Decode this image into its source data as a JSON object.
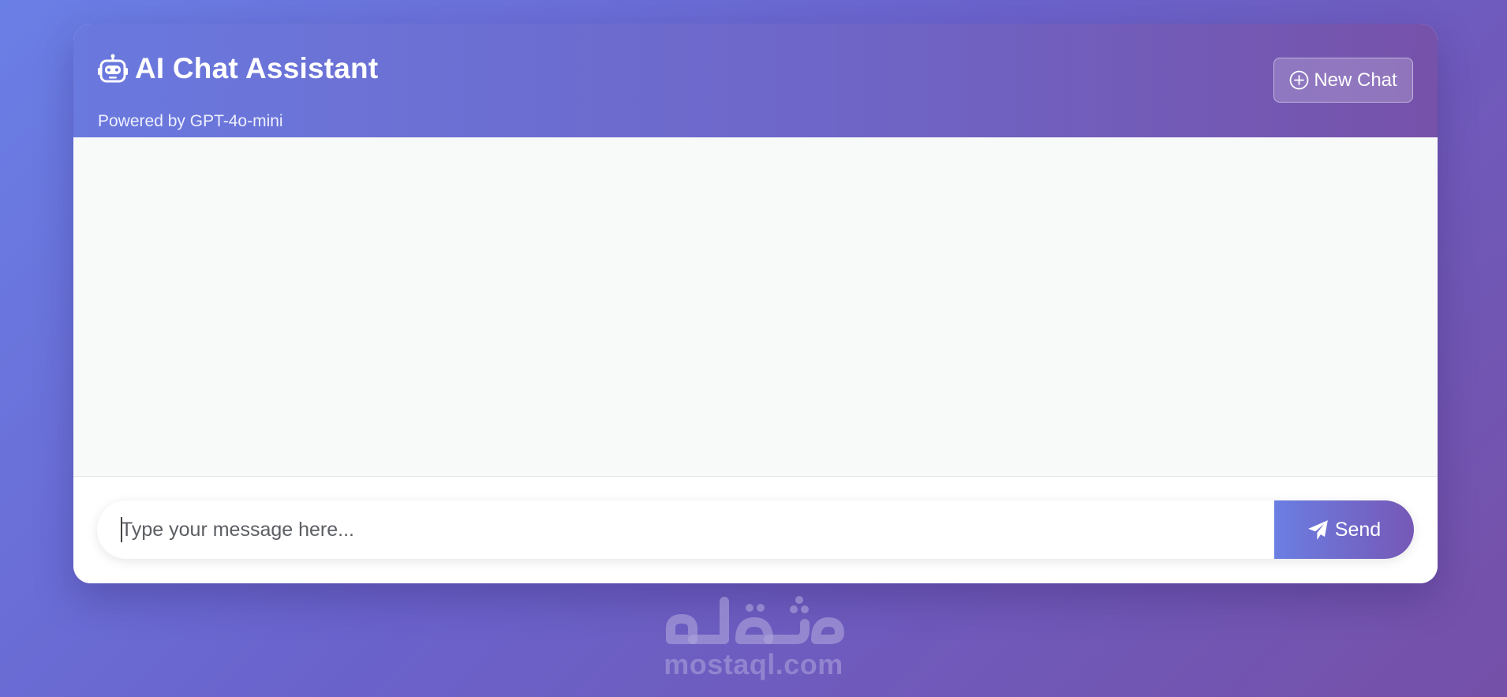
{
  "header": {
    "title": "AI Chat Assistant",
    "subtitle": "Powered by GPT-4o-mini",
    "title_icon": "robot-icon",
    "new_chat_label": "New Chat",
    "new_chat_icon": "plus-circle-icon"
  },
  "composer": {
    "placeholder": "Type your message here...",
    "value": "",
    "send_label": "Send",
    "send_icon": "paper-plane-icon"
  },
  "watermark": {
    "logo_text": "مستقل",
    "site": "mostaql.com"
  },
  "colors": {
    "background_start": "#6a7fe6",
    "background_end": "#7550a8",
    "header_start": "#6a79de",
    "header_end": "#7652aa",
    "chat_area": "#f8f9f9"
  }
}
